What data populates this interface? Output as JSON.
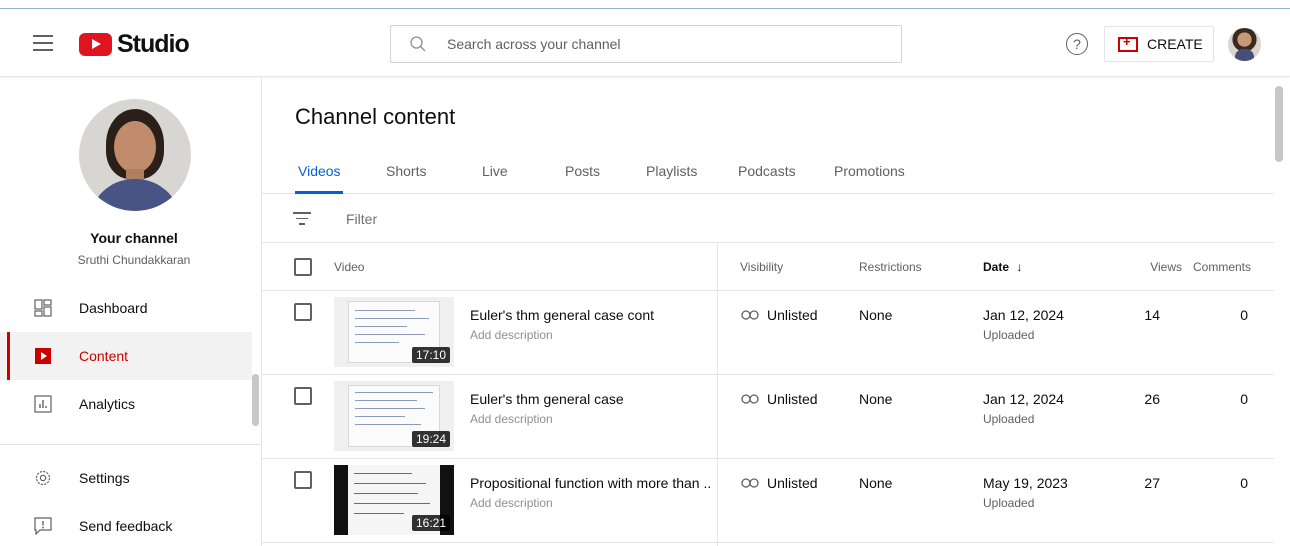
{
  "header": {
    "logo_text": "Studio",
    "search_placeholder": "Search across your channel",
    "help_glyph": "?",
    "create_label": "CREATE"
  },
  "sidebar": {
    "channel_title": "Your channel",
    "channel_name": "Sruthi Chundakkaran",
    "items": [
      {
        "label": "Dashboard",
        "icon": "dashboard-icon"
      },
      {
        "label": "Content",
        "icon": "content-icon",
        "active": true
      },
      {
        "label": "Analytics",
        "icon": "analytics-icon"
      }
    ],
    "bottom_items": [
      {
        "label": "Settings",
        "icon": "gear-icon"
      },
      {
        "label": "Send feedback",
        "icon": "feedback-icon"
      }
    ]
  },
  "main": {
    "title": "Channel content",
    "tabs": [
      "Videos",
      "Shorts",
      "Live",
      "Posts",
      "Playlists",
      "Podcasts",
      "Promotions"
    ],
    "active_tab": "Videos",
    "filter_label": "Filter",
    "columns": {
      "video": "Video",
      "visibility": "Visibility",
      "restrictions": "Restrictions",
      "date": "Date",
      "date_sort": "↓",
      "views": "Views",
      "comments": "Comments"
    },
    "rows": [
      {
        "title": "Euler's thm general case cont",
        "description": "Add description",
        "duration": "17:10",
        "visibility": "Unlisted",
        "restrictions": "None",
        "date": "Jan 12, 2024",
        "date_status": "Uploaded",
        "views": "14",
        "comments": "0"
      },
      {
        "title": "Euler's thm general case",
        "description": "Add description",
        "duration": "19:24",
        "visibility": "Unlisted",
        "restrictions": "None",
        "date": "Jan 12, 2024",
        "date_status": "Uploaded",
        "views": "26",
        "comments": "0"
      },
      {
        "title": "Propositional function with more than ...",
        "description": "Add description",
        "duration": "16:21",
        "visibility": "Unlisted",
        "restrictions": "None",
        "date": "May 19, 2023",
        "date_status": "Uploaded",
        "views": "27",
        "comments": "0"
      }
    ]
  },
  "colors": {
    "brand_red": "#e0141e",
    "active_red": "#cc0000",
    "tab_blue": "#065fd4"
  }
}
